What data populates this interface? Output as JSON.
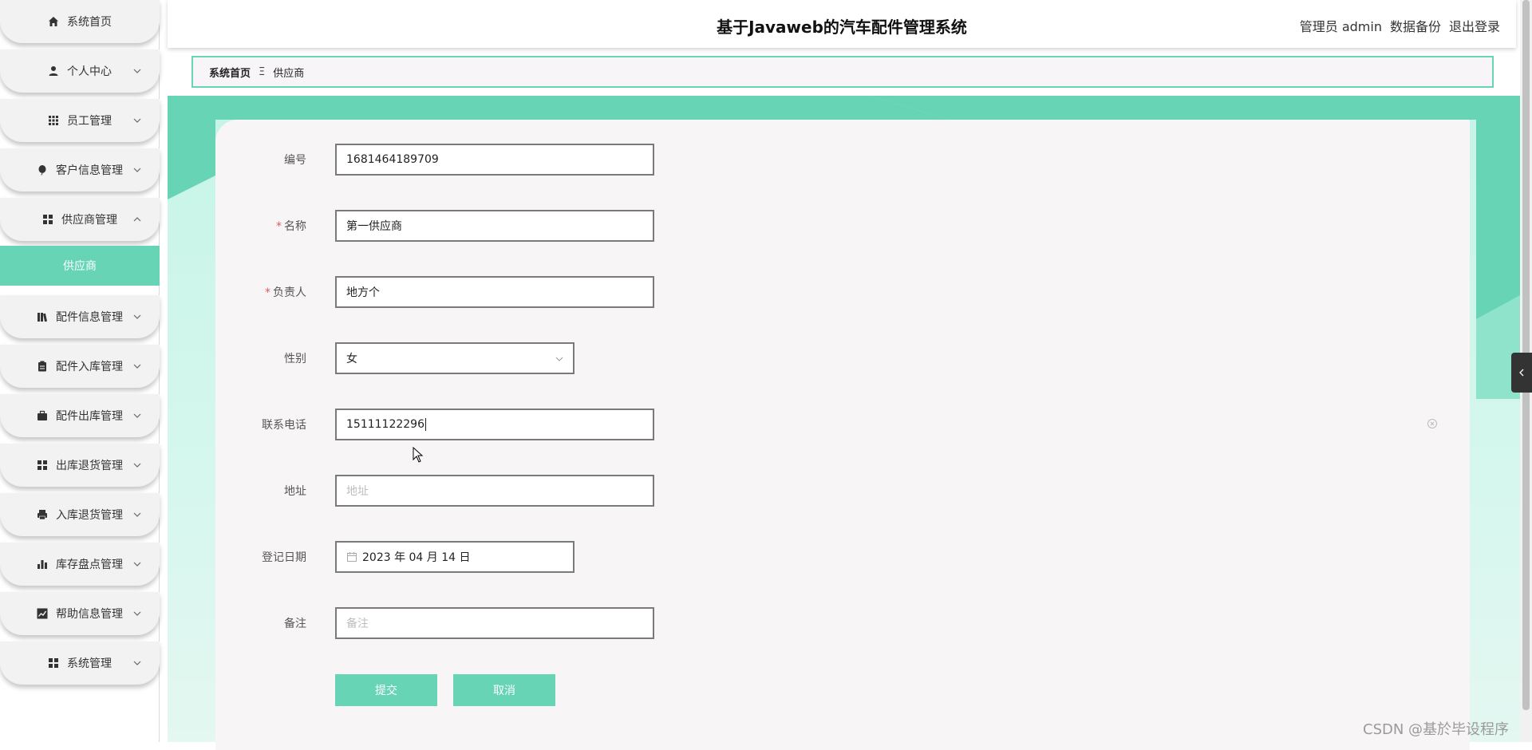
{
  "app": {
    "title": "基于Javaweb的汽车配件管理系统",
    "user": "管理员 admin",
    "backup": "数据备份",
    "logout": "退出登录"
  },
  "sidebar": {
    "items": [
      {
        "label": "系统首页",
        "icon": "home-icon"
      },
      {
        "label": "个人中心",
        "icon": "user-icon"
      },
      {
        "label": "员工管理",
        "icon": "grid-icon"
      },
      {
        "label": "客户信息管理",
        "icon": "balloon-icon"
      },
      {
        "label": "供应商管理",
        "icon": "apps-icon"
      },
      {
        "label": "配件信息管理",
        "icon": "books-icon"
      },
      {
        "label": "配件入库管理",
        "icon": "clipboard-icon"
      },
      {
        "label": "配件出库管理",
        "icon": "briefcase-icon"
      },
      {
        "label": "出库退货管理",
        "icon": "apps-icon"
      },
      {
        "label": "入库退货管理",
        "icon": "printer-icon"
      },
      {
        "label": "库存盘点管理",
        "icon": "bar-chart-icon"
      },
      {
        "label": "帮助信息管理",
        "icon": "line-chart-icon"
      },
      {
        "label": "系统管理",
        "icon": "apps-icon"
      }
    ],
    "active_sub": "供应商"
  },
  "breadcrumb": {
    "home": "系统首页",
    "separator": "Ξ",
    "current": "供应商"
  },
  "form": {
    "code": {
      "label": "编号",
      "value": "1681464189709"
    },
    "name": {
      "label": "名称",
      "value": "第一供应商",
      "required": true
    },
    "manager": {
      "label": "负责人",
      "value": "地方个",
      "required": true
    },
    "gender": {
      "label": "性别",
      "value": "女"
    },
    "phone": {
      "label": "联系电话",
      "value": "15111122296"
    },
    "address": {
      "label": "地址",
      "placeholder": "地址"
    },
    "date": {
      "label": "登记日期",
      "value": "2023 年 04 月 14 日"
    },
    "remark": {
      "label": "备注",
      "placeholder": "备注"
    },
    "submit": "提交",
    "cancel": "取消"
  },
  "watermark": "CSDN @基於毕设程序",
  "colors": {
    "accent": "#66d4b5",
    "required": "#e05a5a"
  }
}
